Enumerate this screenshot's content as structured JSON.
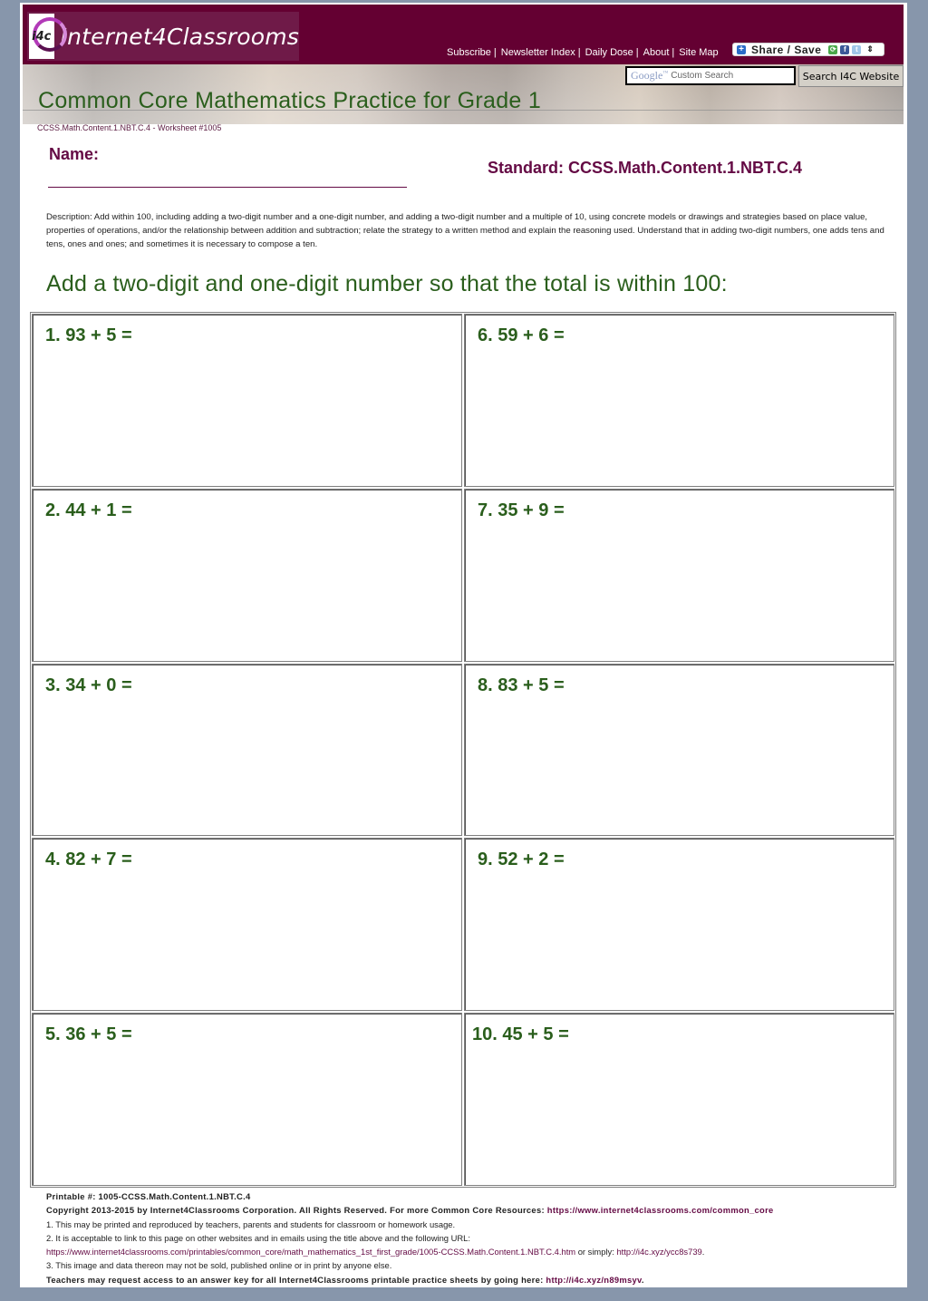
{
  "header": {
    "logo_badge": "i4c",
    "logo_text": "Internet4Classrooms",
    "nav": [
      {
        "label": "Subscribe"
      },
      {
        "label": "Newsletter Index"
      },
      {
        "label": "Daily Dose"
      },
      {
        "label": "About"
      },
      {
        "label": "Site Map"
      }
    ],
    "nav_separator": "|",
    "share": {
      "plus_icon": "+",
      "label": "Share / Save",
      "icons": [
        "addthis-icon",
        "facebook-icon",
        "twitter-icon"
      ],
      "arrows": "⇕"
    }
  },
  "banner": {
    "title": "Common Core Mathematics Practice for Grade 1",
    "search": {
      "google_mark": "Google",
      "tm": "™",
      "placeholder": "Custom Search",
      "button_label": "Search I4C Website"
    }
  },
  "worksheet_id": "CCSS.Math.Content.1.NBT.C.4 - Worksheet #1005",
  "name_label": "Name:",
  "standard": "Standard: CCSS.Math.Content.1.NBT.C.4",
  "description": "Description: Add within 100, including adding a two-digit number and a one-digit number, and adding a two-digit number and a multiple of 10, using concrete models or drawings and strategies based on place value, properties of operations, and/or the relationship between addition and subtraction; relate the strategy to a written method and explain the reasoning used. Understand that in adding two-digit numbers, one adds tens and tens, ones and ones; and sometimes it is necessary to compose a ten.",
  "instructions": "Add a two-digit and one-digit number so that the total is within 100:",
  "problems": [
    {
      "text": "1. 93 + 5 ="
    },
    {
      "text": "2. 44 + 1 ="
    },
    {
      "text": "3. 34 + 0 ="
    },
    {
      "text": "4. 82 + 7 ="
    },
    {
      "text": "5. 36 + 5 ="
    },
    {
      "text": "6. 59 + 6 ="
    },
    {
      "text": "7. 35 + 9 ="
    },
    {
      "text": "8. 83 + 5 ="
    },
    {
      "text": "9. 52 + 2 ="
    },
    {
      "text": "10. 45 + 5 ="
    }
  ],
  "footer": {
    "printable": "Printable #: 1005-CCSS.Math.Content.1.NBT.C.4",
    "copyright": "Copyright 2013-2015 by Internet4Classrooms Corporation. All Rights Reserved. For more Common Core Resources: ",
    "copyright_link": "https://www.internet4classrooms.com/common_core",
    "note1": "1. This may be printed and reproduced by teachers, parents and students for classroom or homework usage.",
    "note2": "2. It is acceptable to link to this page on other websites and in emails using the title above and the following URL:",
    "url_long": "https://www.internet4classrooms.com/printables/common_core/math_mathematics_1st_first_grade/1005-CCSS.Math.Content.1.NBT.C.4.htm",
    "or_simply": " or simply: ",
    "url_short": "http://i4c.xyz/ycc8s739",
    "period": ".",
    "note3": "3. This image and data thereon may not be sold, published online or in print by anyone else.",
    "answer_key": "Teachers may request access to an answer key for all Internet4Classrooms printable practice sheets by going here: ",
    "answer_key_link": "http://i4c.xyz/n89msyv",
    "answer_key_period": "."
  },
  "colors": {
    "header_bg": "#640032",
    "title_green": "#2a5e1c",
    "accent_maroon": "#640a44",
    "page_bg": "#8796ab"
  }
}
